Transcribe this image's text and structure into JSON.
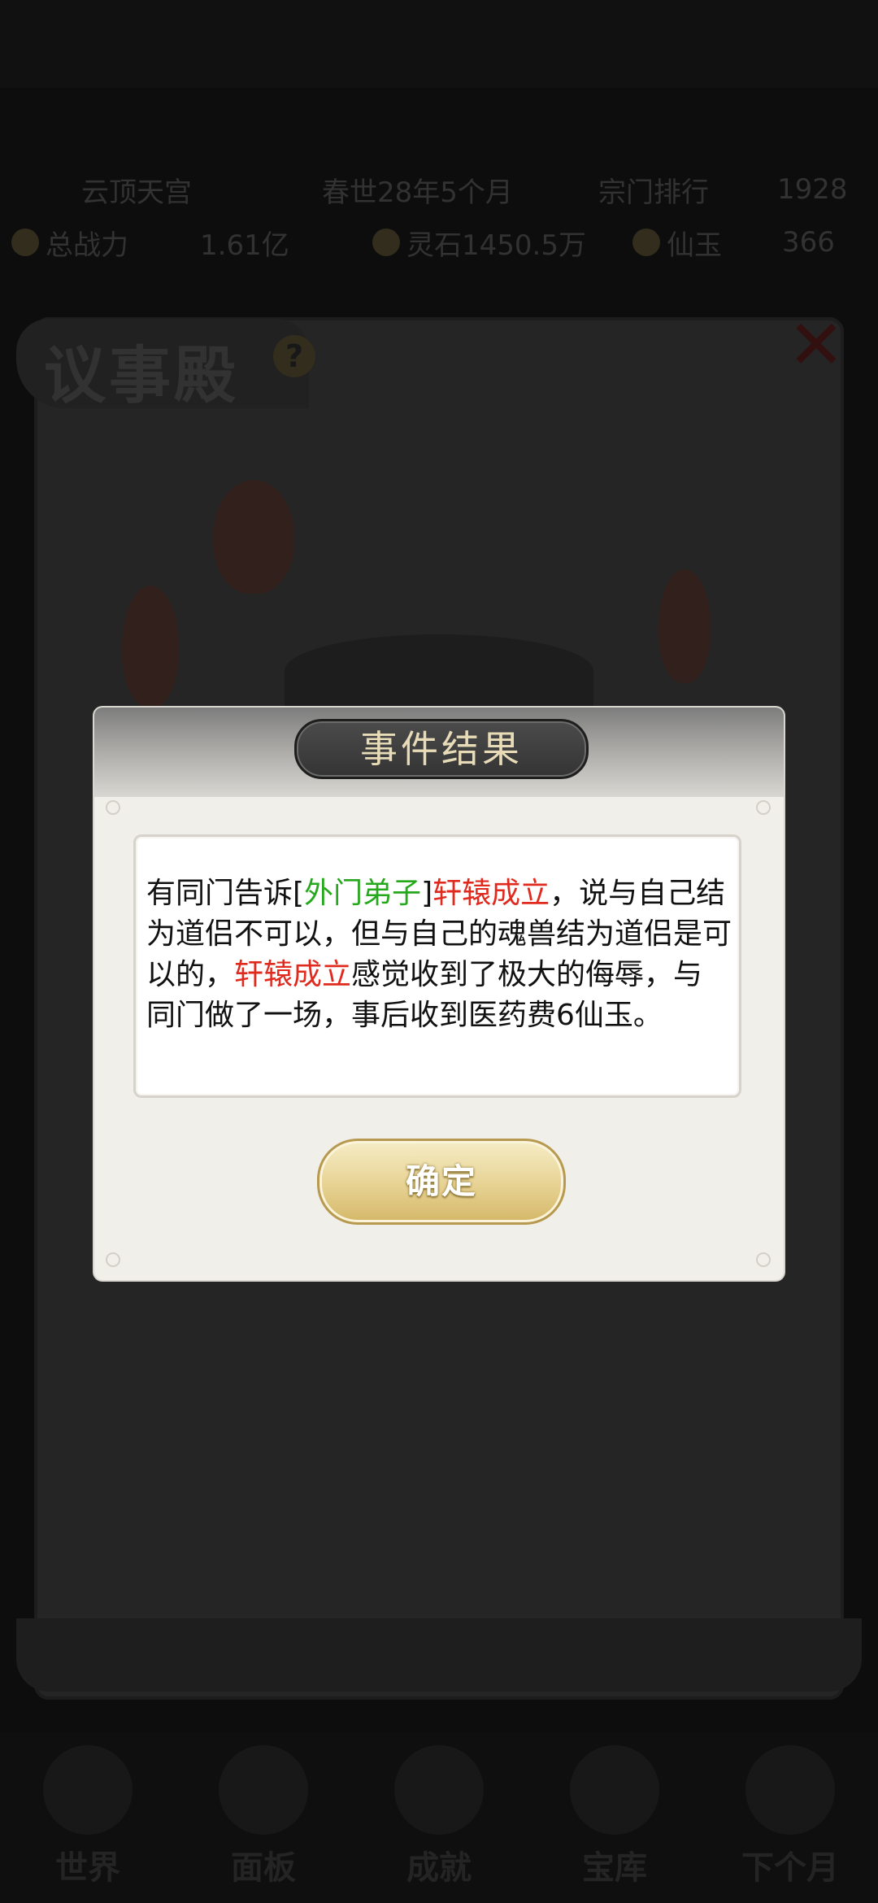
{
  "status_bar": {
    "sect_name": "云顶天宫",
    "date": "春世28年5个月",
    "rank_label": "宗门排行",
    "rank_value": "1928"
  },
  "stats_bar": {
    "power_label": "总战力",
    "power_value": "1.61亿",
    "spirit_stone": "灵石1450.5万",
    "fairy_jade_label": "仙玉",
    "fairy_jade_value": "366"
  },
  "hall": {
    "title": "议事殿",
    "help_glyph": "?",
    "close_glyph": "✕"
  },
  "dialog": {
    "title": "事件结果",
    "message_parts": [
      {
        "text": "有同门告诉[",
        "color": "default"
      },
      {
        "text": "外门弟子",
        "color": "green"
      },
      {
        "text": "]",
        "color": "default"
      },
      {
        "text": "轩辕成立",
        "color": "red"
      },
      {
        "text": "，说与自己结为道侣不可以，但与自己的魂兽结为道侣是可以的，",
        "color": "default"
      },
      {
        "text": "轩辕成立",
        "color": "red"
      },
      {
        "text": "感觉收到了极大的侮辱，与同门做了一场，事后收到医药费6仙玉。",
        "color": "default"
      }
    ],
    "confirm_label": "确定"
  },
  "bottom_nav": {
    "items": [
      {
        "label": "世界"
      },
      {
        "label": "面板"
      },
      {
        "label": "成就"
      },
      {
        "label": "宝库"
      },
      {
        "label": "下个月"
      }
    ]
  },
  "colors": {
    "highlight_green": "#26a81c",
    "highlight_red": "#e02a1e",
    "button_gold": "#e7d293",
    "title_text": "#e8dcb8"
  }
}
